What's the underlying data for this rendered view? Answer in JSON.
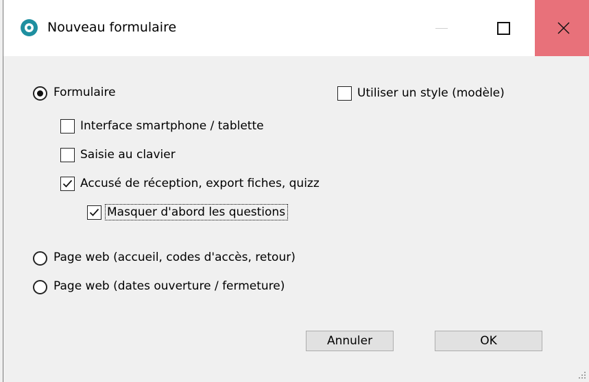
{
  "window": {
    "title": "Nouveau formulaire",
    "icon": "app-logo-icon",
    "controls": [
      "minimize-icon",
      "maximize-icon",
      "close-icon"
    ],
    "accent_close": "#e8717a"
  },
  "options": {
    "radio_formulaire": {
      "label": "Formulaire",
      "checked": true
    },
    "use_style": {
      "label": "Utiliser un style (modèle)",
      "checked": false
    },
    "smartphone": {
      "label": "Interface smartphone / tablette",
      "checked": false
    },
    "keyboard": {
      "label": "Saisie au clavier",
      "checked": false
    },
    "receipt": {
      "label": "Accusé de réception, export fiches, quizz",
      "checked": true
    },
    "hide_questions": {
      "label": "Masquer d'abord les questions",
      "checked": true
    },
    "radio_web_access": {
      "label": "Page web (accueil, codes d'accès, retour)",
      "checked": false
    },
    "radio_web_dates": {
      "label": "Page web (dates ouverture / fermeture)",
      "checked": false
    }
  },
  "buttons": {
    "cancel": "Annuler",
    "ok": "OK"
  }
}
